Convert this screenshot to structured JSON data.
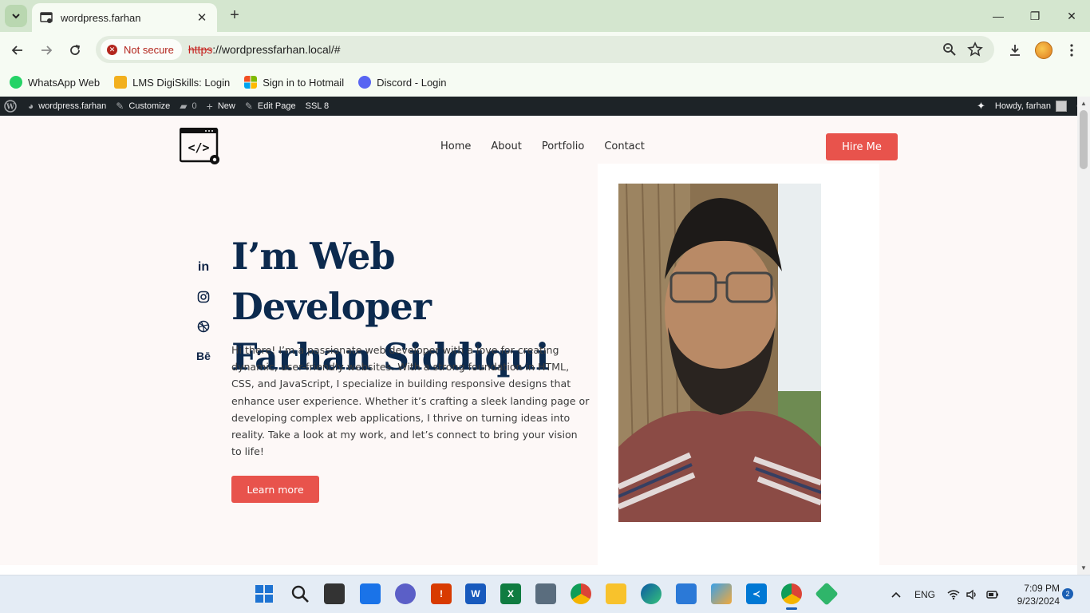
{
  "browser": {
    "tab_title": "wordpress.farhan",
    "security_label": "Not secure",
    "url_scheme": "https",
    "url_rest": "://wordpressfarhan.local/#",
    "bookmarks": [
      {
        "label": "WhatsApp Web",
        "color": "#25d366"
      },
      {
        "label": "LMS DigiSkills: Login",
        "color": "#f2b01e"
      },
      {
        "label": "Sign in to Hotmail",
        "color": "#0078d4"
      },
      {
        "label": "Discord  - Login",
        "color": "#5865f2"
      }
    ]
  },
  "adminbar": {
    "site_name": "wordpress.farhan",
    "customize": "Customize",
    "comments_count": "0",
    "new": "New",
    "edit_page": "Edit Page",
    "ssl": "SSL 8",
    "howdy": "Howdy, farhan"
  },
  "site": {
    "nav": [
      "Home",
      "About",
      "Portfolio",
      "Contact"
    ],
    "hire_label": "Hire Me",
    "hero_title_line1": "I’m Web Developer",
    "hero_title_line2": "Farhan Siddiqui",
    "hero_text": "Hi there! I’m a passionate web developer with a love for creating dynamic, user-friendly websites. With a strong foundation in HTML, CSS, and JavaScript, I specialize in building responsive designs that enhance user experience. Whether it’s crafting a sleek landing page or developing complex web applications, I thrive on turning ideas into reality. Take a look at my work, and let’s connect to bring your vision to life!",
    "learn_more_label": "Learn more",
    "social_icons": [
      "linkedin-icon",
      "instagram-icon",
      "dribbble-icon",
      "behance-icon"
    ],
    "accent_color": "#e8534c",
    "heading_color": "#0c2a4e"
  },
  "taskbar": {
    "language": "ENG",
    "time": "7:09 PM",
    "date": "9/23/2024",
    "notification_count": "2"
  }
}
